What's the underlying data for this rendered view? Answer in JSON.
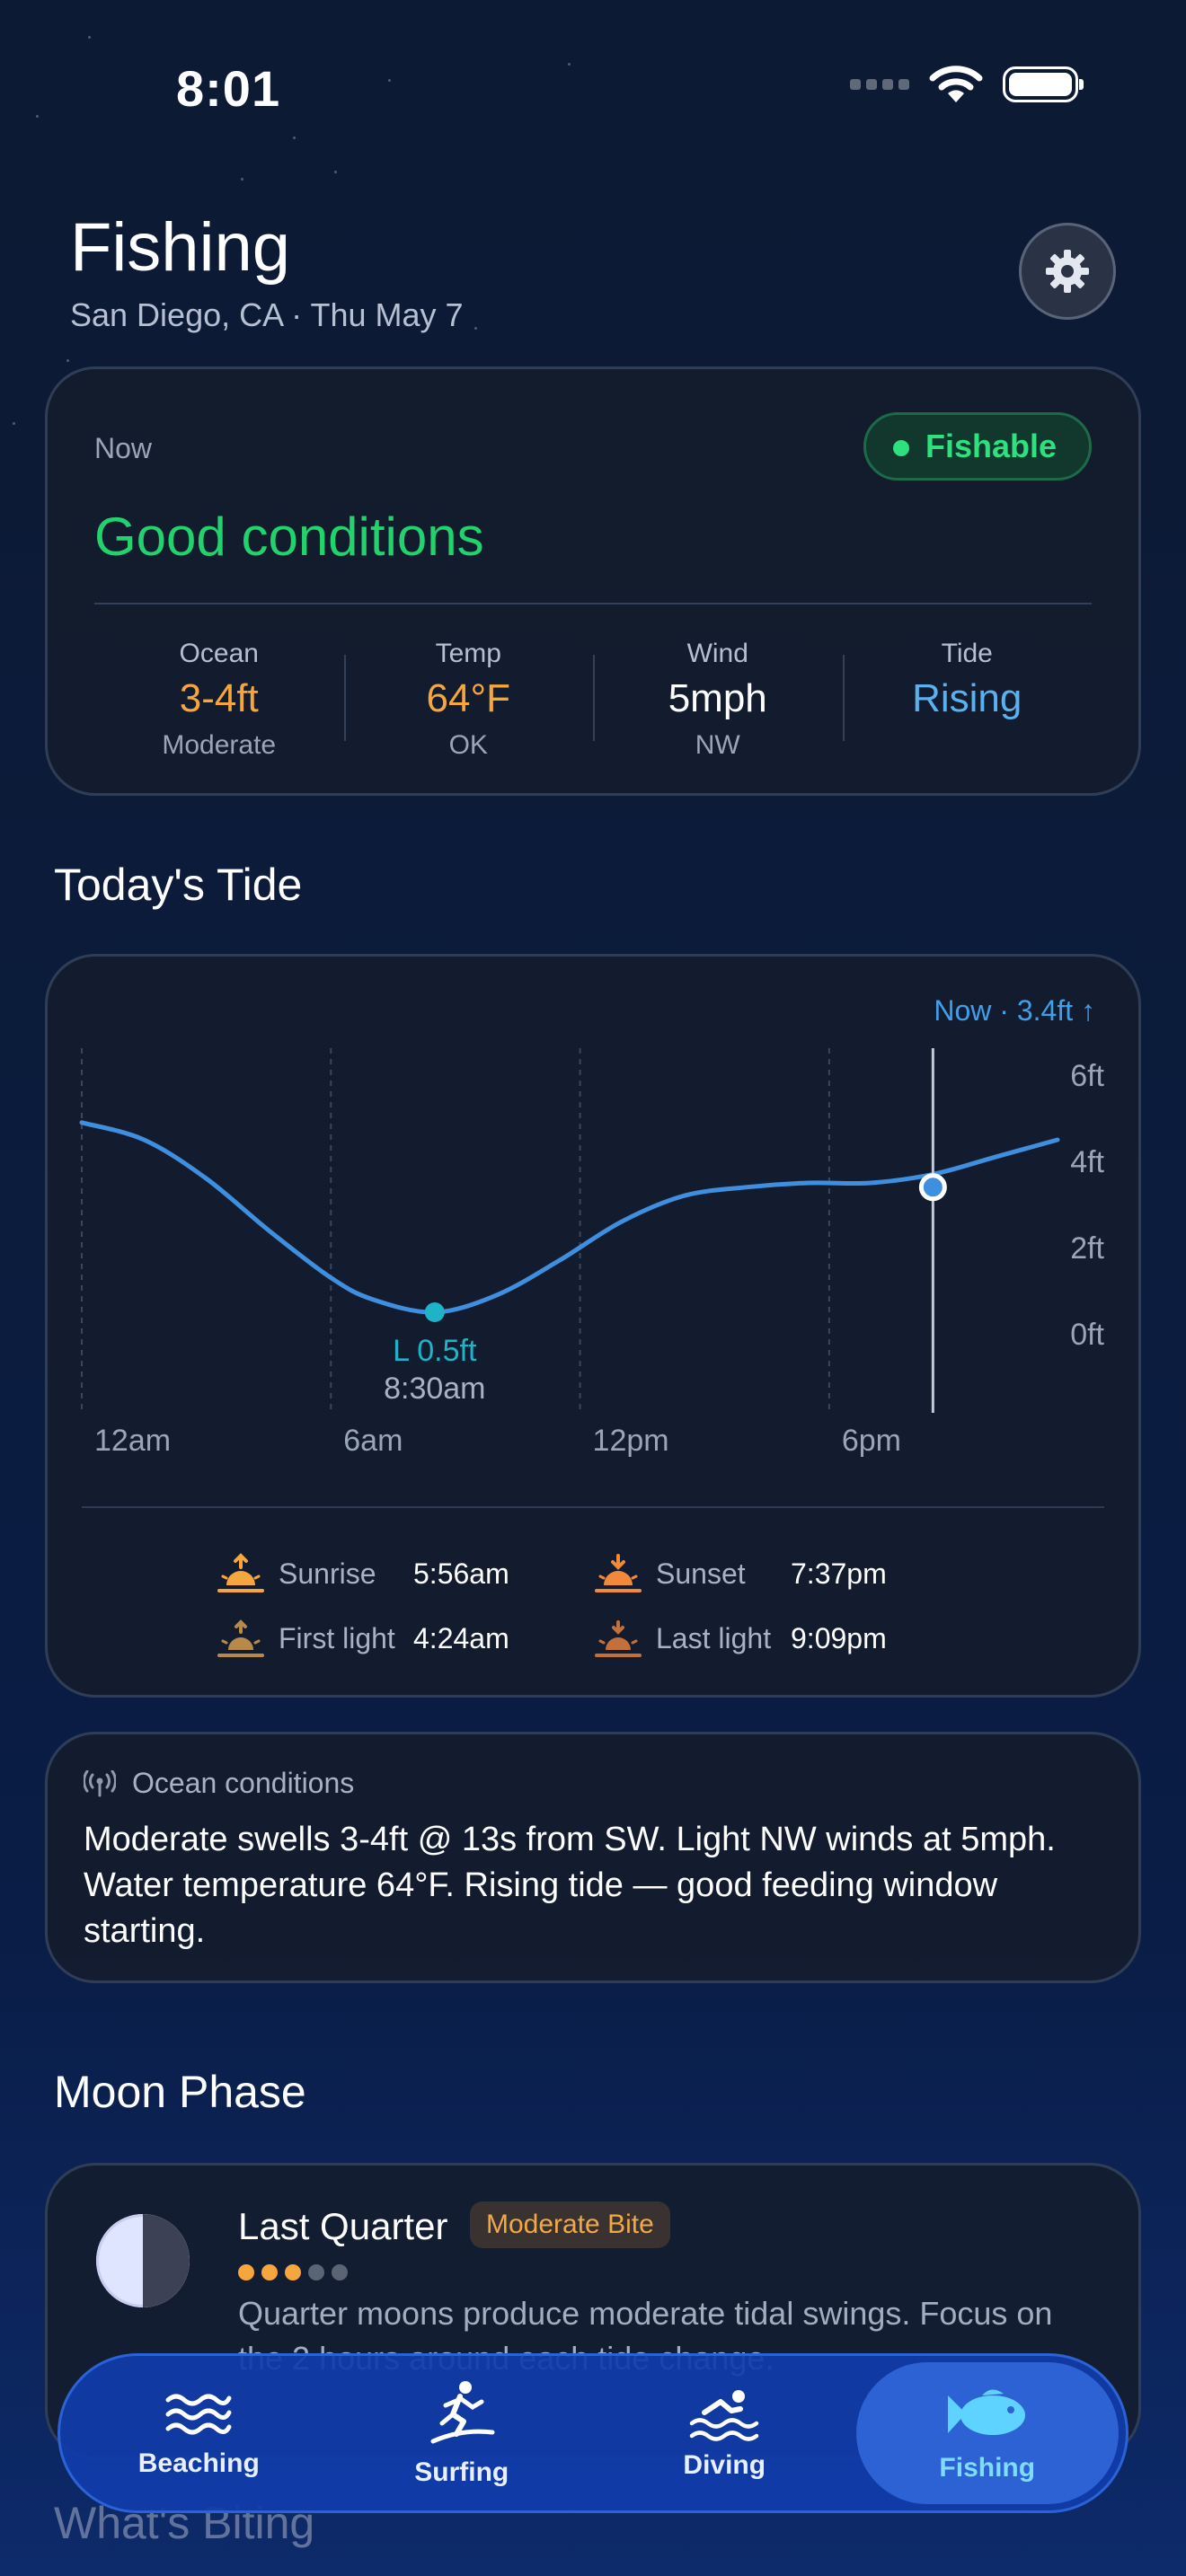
{
  "status_bar": {
    "time": "8:01"
  },
  "header": {
    "title": "Fishing",
    "subtitle": "San Diego, CA · Thu May 7"
  },
  "now_card": {
    "label": "Now",
    "badge": "Fishable",
    "condition": "Good conditions",
    "stats": [
      {
        "label": "Ocean",
        "value": "3-4ft",
        "sub": "Moderate",
        "color": "#f5a63d"
      },
      {
        "label": "Temp",
        "value": "64°F",
        "sub": "OK",
        "color": "#f5a63d"
      },
      {
        "label": "Wind",
        "value": "5mph",
        "sub": "NW",
        "color": "#ffffff"
      },
      {
        "label": "Tide",
        "value": "Rising",
        "sub": "",
        "color": "#5ab1f0"
      }
    ]
  },
  "tide_section": {
    "title": "Today's Tide"
  },
  "chart_data": {
    "type": "line",
    "title": "",
    "now_label": "Now · 3.4ft ↑",
    "x_tick_labels": [
      "12am",
      "6am",
      "12pm",
      "6pm"
    ],
    "y_tick_labels": [
      "6ft",
      "4ft",
      "2ft",
      "0ft"
    ],
    "ylim": [
      0,
      6
    ],
    "xlim_hours": [
      0,
      23.5
    ],
    "series": [
      {
        "x_hours": [
          0,
          1.5,
          3,
          4.5,
          6,
          7,
          8.5,
          10,
          11.5,
          13,
          14.5,
          16,
          17.5,
          19,
          20.5,
          22,
          23.5
        ],
        "y_ft": [
          4.9,
          4.5,
          3.6,
          2.4,
          1.3,
          0.8,
          0.5,
          0.9,
          1.7,
          2.6,
          3.2,
          3.4,
          3.5,
          3.5,
          3.7,
          4.1,
          4.5
        ]
      }
    ],
    "annotations": [
      {
        "label": "L 0.5ft",
        "time": "8:30am",
        "x_hours": 8.5,
        "y_ft": 0.5
      }
    ],
    "now_marker": {
      "x_hours": 20.5,
      "y_ft": 3.4
    },
    "grid": "vertical dashed"
  },
  "sun_times": [
    {
      "label": "Sunrise",
      "value": "5:56am",
      "icon": "sunrise-icon"
    },
    {
      "label": "Sunset",
      "value": "7:37pm",
      "icon": "sunset-icon"
    },
    {
      "label": "First light",
      "value": "4:24am",
      "icon": "first-light-icon"
    },
    {
      "label": "Last light",
      "value": "9:09pm",
      "icon": "last-light-icon"
    }
  ],
  "ocean_conditions": {
    "title": "Ocean conditions",
    "body": "Moderate swells 3-4ft @ 13s from SW. Light NW winds at 5mph. Water temperature 64°F. Rising tide — good feeding window starting."
  },
  "moon_section": {
    "title": "Moon Phase",
    "phase": "Last Quarter",
    "bite": "Moderate Bite",
    "bite_level": 3,
    "bite_max": 5,
    "description": "Quarter moons produce moderate tidal swings. Focus on the 2 hours around each tide change."
  },
  "next_section_title": "What's Biting",
  "tabs": [
    {
      "label": "Beaching",
      "icon": "waves-icon",
      "active": false
    },
    {
      "label": "Surfing",
      "icon": "surfer-icon",
      "active": false
    },
    {
      "label": "Diving",
      "icon": "swimmer-icon",
      "active": false
    },
    {
      "label": "Fishing",
      "icon": "fish-icon",
      "active": true
    }
  ]
}
